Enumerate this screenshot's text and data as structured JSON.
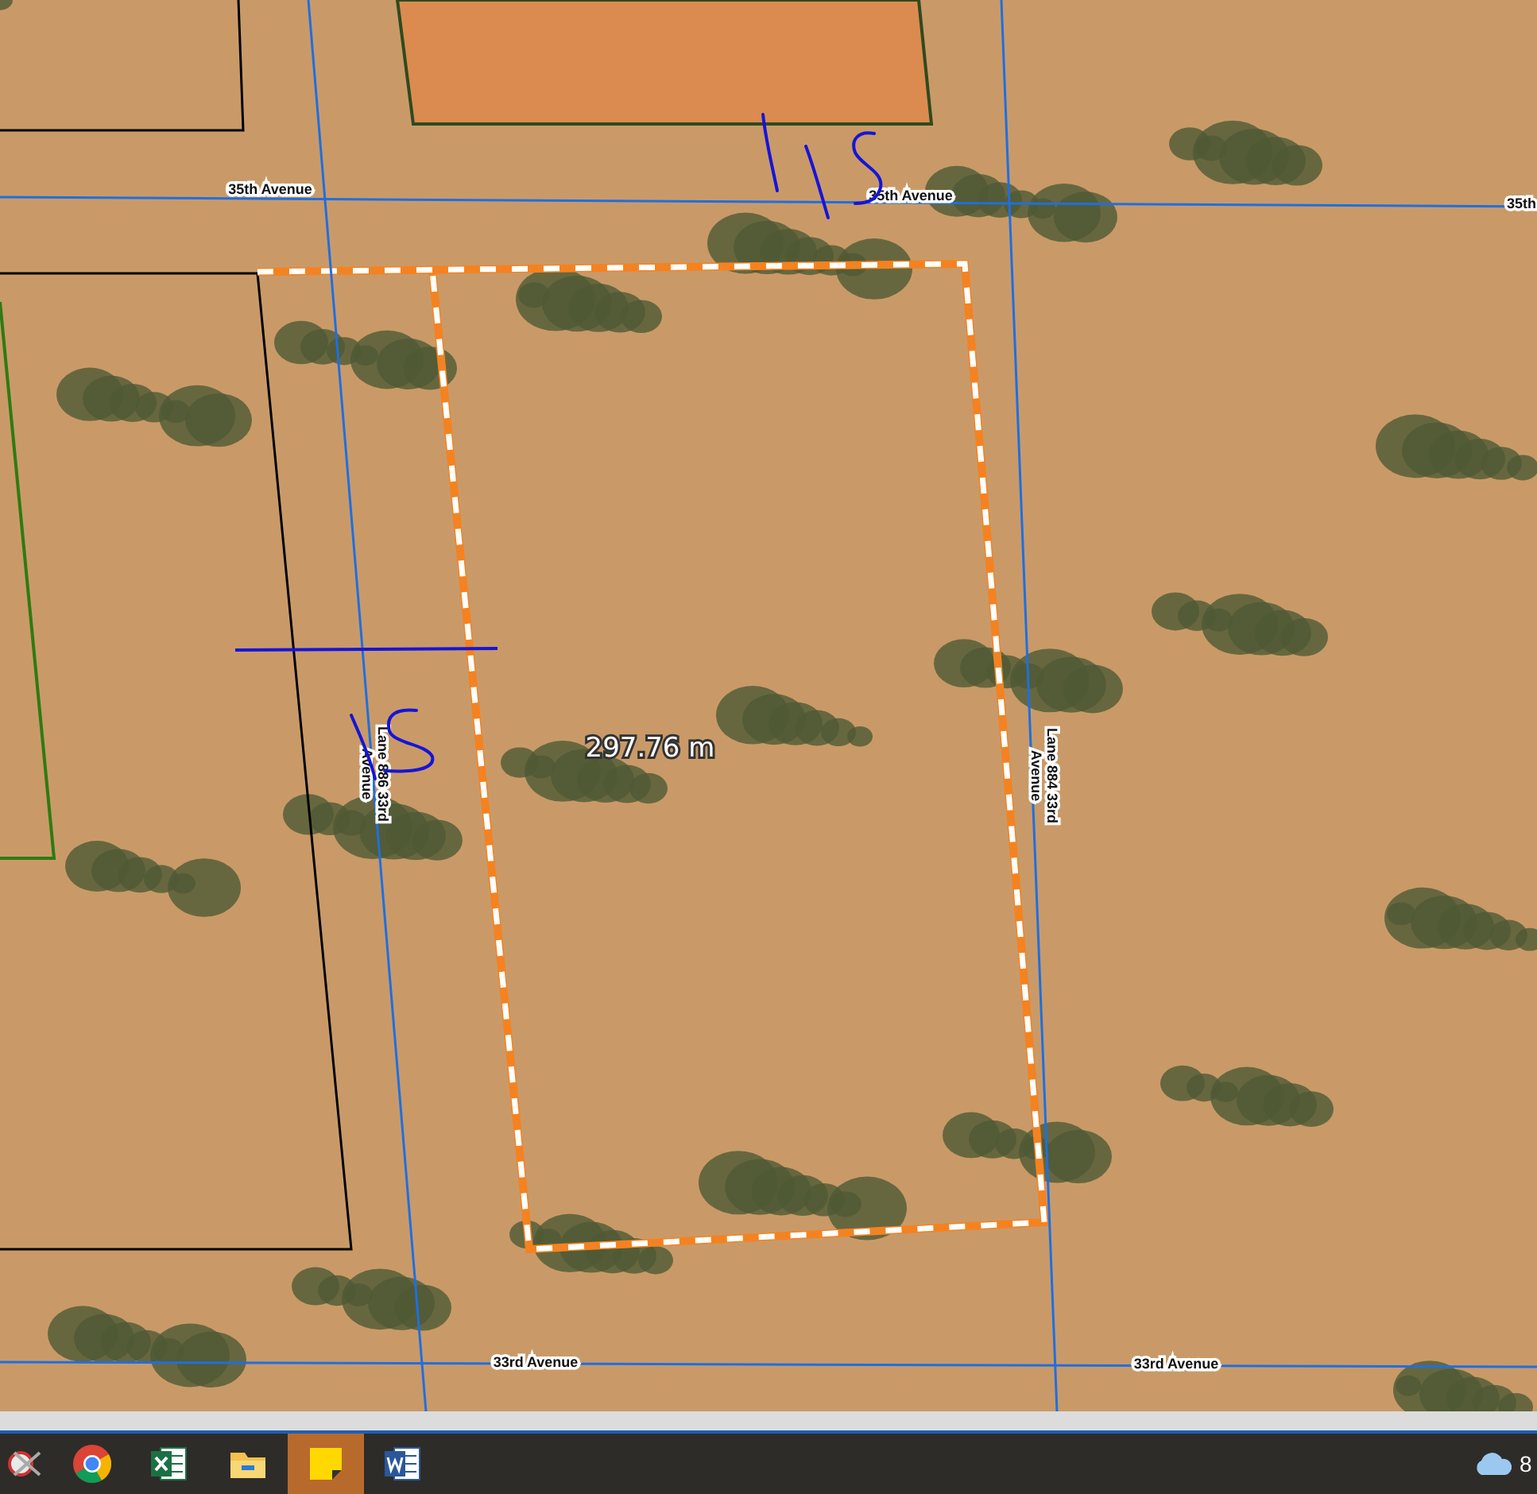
{
  "map": {
    "road_labels": [
      {
        "kind": "horizontal",
        "text": "35th Avenue"
      },
      {
        "kind": "horizontal",
        "text": "35th Avenue"
      },
      {
        "kind": "horizontal",
        "text": "35th"
      },
      {
        "kind": "vertical",
        "lines": [
          "Lane 886 33rd",
          "Avenue"
        ]
      },
      {
        "kind": "vertical",
        "lines": [
          "Lane 884 33rd",
          "Avenue"
        ]
      },
      {
        "kind": "horizontal",
        "text": "33rd Avenue"
      },
      {
        "kind": "horizontal",
        "text": "33rd Avenue"
      }
    ],
    "measurement": "297.76 m"
  },
  "taskbar": {
    "apps": [
      {
        "kind": "snipping",
        "selected": false
      },
      {
        "kind": "chrome",
        "selected": false
      },
      {
        "kind": "excel",
        "selected": false
      },
      {
        "kind": "explorer",
        "selected": false
      },
      {
        "kind": "sticky",
        "selected": true
      },
      {
        "kind": "word",
        "selected": false
      }
    ],
    "clock": "8"
  }
}
